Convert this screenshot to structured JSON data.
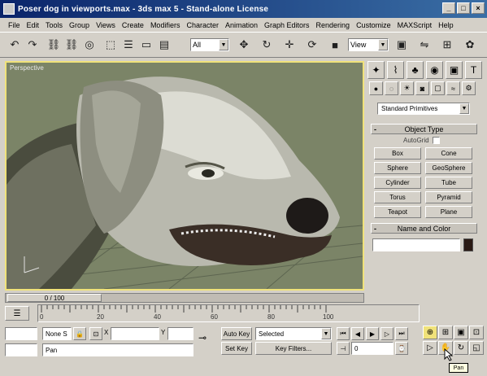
{
  "window": {
    "title": "Poser dog in viewports.max - 3ds max 5 - Stand-alone License",
    "controls": [
      "minimize",
      "maximize",
      "close"
    ]
  },
  "menu": [
    "File",
    "Edit",
    "Tools",
    "Group",
    "Views",
    "Create",
    "Modifiers",
    "Character",
    "Animation",
    "Graph Editors",
    "Rendering",
    "Customize",
    "MAXScript",
    "Help"
  ],
  "toolbar": {
    "selection_filter": "All",
    "reference_coord": "View"
  },
  "viewport": {
    "label": "Perspective",
    "border_color": "#f0e27a"
  },
  "command_panel": {
    "category": "Standard Primitives",
    "object_type_header": "Object Type",
    "autogrid_label": "AutoGrid",
    "object_buttons": [
      "Box",
      "Cone",
      "Sphere",
      "GeoSphere",
      "Cylinder",
      "Tube",
      "Torus",
      "Pyramid",
      "Teapot",
      "Plane"
    ],
    "name_color_header": "Name and Color",
    "object_color": "#2a1a14"
  },
  "timeline": {
    "slider_label": "0 / 100",
    "ticks": [
      "0",
      "20",
      "40",
      "60",
      "80",
      "100"
    ]
  },
  "status": {
    "selection_info": "None S",
    "x_label": "X",
    "y_label": "Y",
    "prompt_text": "Pan",
    "auto_key": "Auto Key",
    "set_key": "Set Key",
    "selected_filter": "Selected",
    "key_filters": "Key Filters...",
    "frame_value": "0",
    "tooltip": "Pan"
  }
}
